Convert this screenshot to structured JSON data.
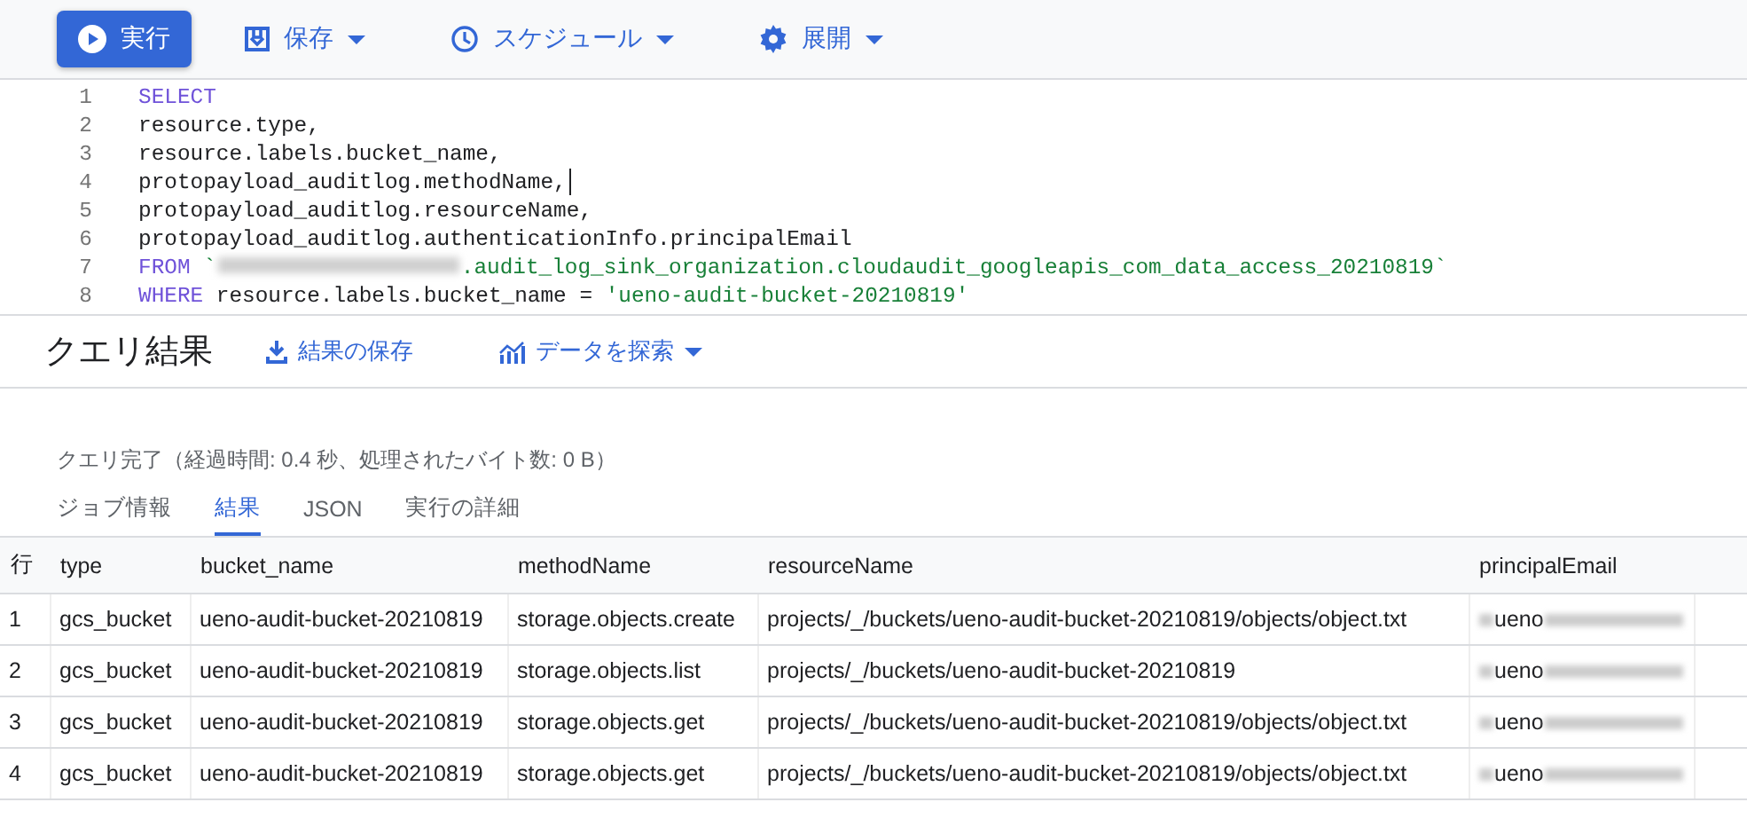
{
  "toolbar": {
    "buttons": [
      {
        "label": "実行",
        "kind": "primary"
      },
      {
        "label": "保存",
        "kind": "menu"
      },
      {
        "label": "スケジュール",
        "kind": "menu"
      },
      {
        "label": "展開",
        "kind": "menu"
      }
    ]
  },
  "editor": {
    "lines": [
      {
        "number": "1",
        "cursor": false,
        "segments": [
          {
            "kind": "keyword",
            "text": "SELECT"
          }
        ]
      },
      {
        "number": "2",
        "cursor": false,
        "segments": [
          {
            "kind": "plain",
            "text": "resource.type,"
          }
        ]
      },
      {
        "number": "3",
        "cursor": false,
        "segments": [
          {
            "kind": "plain",
            "text": "resource.labels.bucket_name,"
          }
        ]
      },
      {
        "number": "4",
        "cursor": true,
        "segments": [
          {
            "kind": "plain",
            "text": "protopayload_auditlog.methodName,"
          }
        ]
      },
      {
        "number": "5",
        "cursor": false,
        "segments": [
          {
            "kind": "plain",
            "text": "protopayload_auditlog.resourceName,"
          }
        ]
      },
      {
        "number": "6",
        "cursor": false,
        "segments": [
          {
            "kind": "plain",
            "text": "protopayload_auditlog.authenticationInfo.principalEmail"
          }
        ]
      },
      {
        "number": "7",
        "cursor": false,
        "segments": [
          {
            "kind": "keyword",
            "text": "FROM"
          },
          {
            "kind": "string",
            "text": "`"
          },
          {
            "kind": "redacted"
          },
          {
            "kind": "string",
            "text": ".audit_log_sink_organization.cloudaudit_googleapis_com_data_access_20210819`"
          }
        ]
      },
      {
        "number": "8",
        "cursor": false,
        "segments": [
          {
            "kind": "keyword",
            "text": "WHERE"
          },
          {
            "kind": "plain",
            "text": "resource.labels.bucket_name ="
          },
          {
            "kind": "string",
            "text": "'ueno-audit-bucket-20210819'"
          }
        ]
      }
    ]
  },
  "results": {
    "title": "クエリ結果",
    "actions": [
      {
        "label": "結果の保存",
        "kind": "download"
      },
      {
        "label": "データを探索",
        "kind": "menu"
      }
    ],
    "status": "クエリ完了（経過時間: 0.4 秒、処理されたバイト数: 0 B）",
    "tabs": [
      {
        "label": "ジョブ情報",
        "selected": false
      },
      {
        "label": "結果",
        "selected": true
      },
      {
        "label": "JSON",
        "selected": false
      },
      {
        "label": "実行の詳細",
        "selected": false
      }
    ],
    "table": {
      "columns": [
        "行",
        "type",
        "bucket_name",
        "methodName",
        "resourceName",
        "principalEmail"
      ],
      "rows": [
        [
          "1",
          "gcs_bucket",
          "ueno-audit-bucket-20210819",
          "storage.objects.create",
          "projects/_/buckets/ueno-audit-bucket-20210819/objects/object.txt",
          {
            "text": "ueno",
            "redacted": true
          }
        ],
        [
          "2",
          "gcs_bucket",
          "ueno-audit-bucket-20210819",
          "storage.objects.list",
          "projects/_/buckets/ueno-audit-bucket-20210819",
          {
            "text": "ueno",
            "redacted": true
          }
        ],
        [
          "3",
          "gcs_bucket",
          "ueno-audit-bucket-20210819",
          "storage.objects.get",
          "projects/_/buckets/ueno-audit-bucket-20210819/objects/object.txt",
          {
            "text": "ueno",
            "redacted": true
          }
        ],
        [
          "4",
          "gcs_bucket",
          "ueno-audit-bucket-20210819",
          "storage.objects.get",
          "projects/_/buckets/ueno-audit-bucket-20210819/objects/object.txt",
          {
            "text": "ueno",
            "redacted": true
          }
        ]
      ]
    }
  }
}
